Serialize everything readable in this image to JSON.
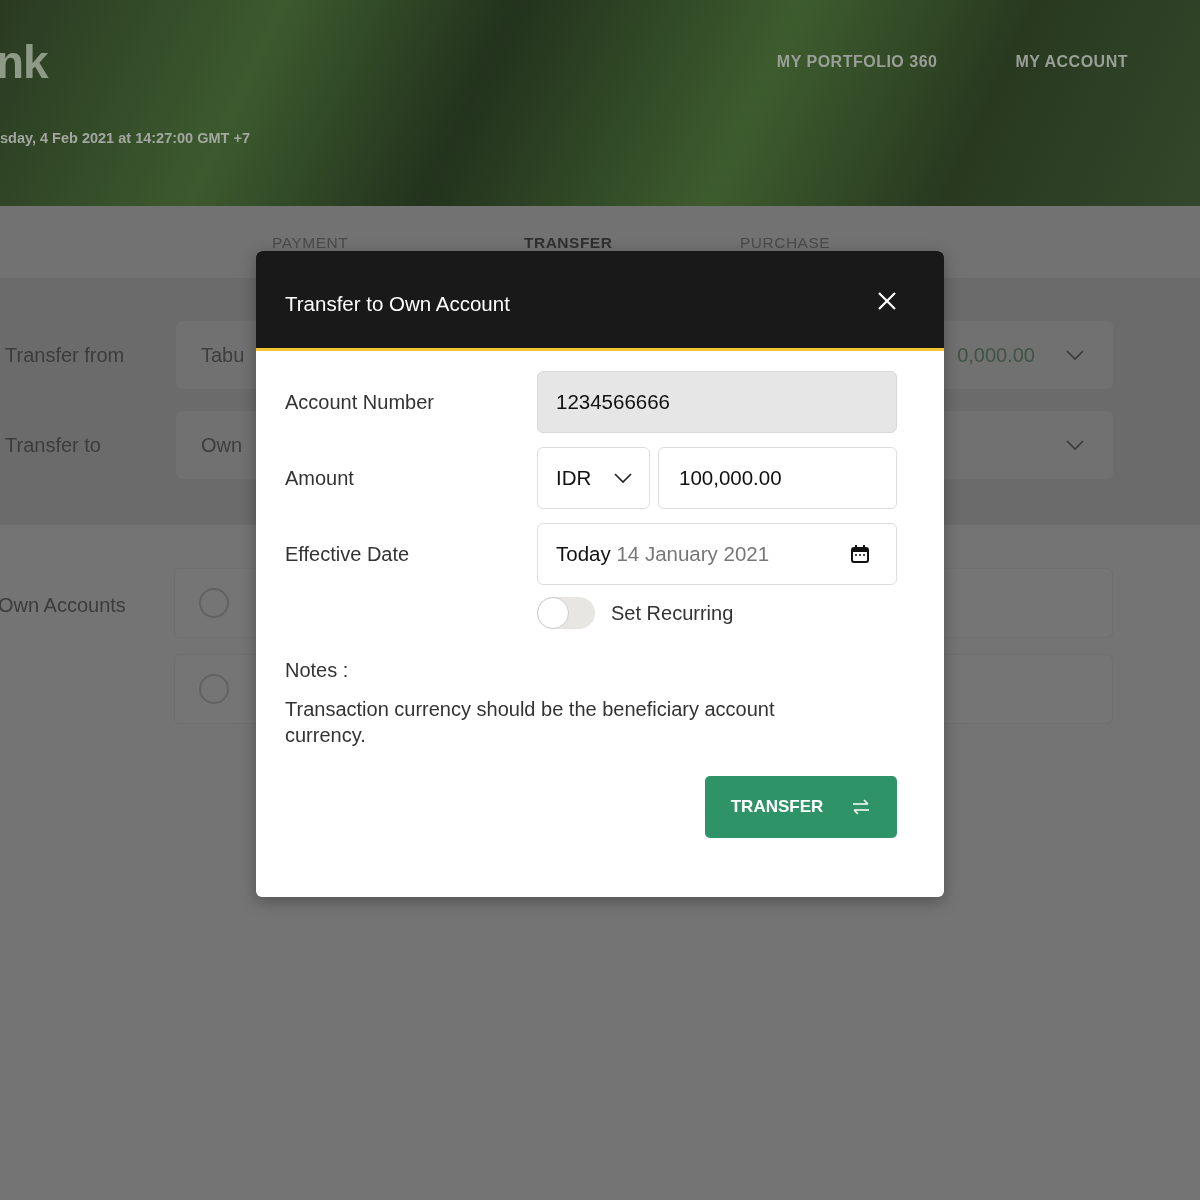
{
  "header": {
    "logo": "nk",
    "nav": [
      "MY PORTFOLIO 360",
      "MY ACCOUNT"
    ],
    "datetime": "sday, 4 Feb 2021 at 14:27:00 GMT +7"
  },
  "tabs": [
    {
      "label": "PAYMENT",
      "selected": false
    },
    {
      "label": "TRANSFER",
      "selected": true
    },
    {
      "label": "PURCHASE",
      "selected": false
    }
  ],
  "transfer_form": {
    "rows": [
      {
        "label": "Transfer from",
        "value": "Tabu",
        "amount": "0,000.00"
      },
      {
        "label": "Transfer to",
        "value": "Own"
      }
    ]
  },
  "own_accounts": {
    "label": "Own Accounts",
    "options": [
      {
        "selected": false
      },
      {
        "selected": false
      }
    ]
  },
  "dialog": {
    "title": "Transfer to Own Account",
    "account_number": {
      "label": "Account Number",
      "value": "1234566666"
    },
    "amount": {
      "label": "Amount",
      "currency": "IDR",
      "value": "100,000.00"
    },
    "effective_date": {
      "label": "Effective Date",
      "prefix": "Today",
      "value": "14 January 2021"
    },
    "recurring": {
      "label": "Set Recurring",
      "on": false
    },
    "notes_label": "Notes :",
    "notes": "Transaction currency should be the beneficiary account currency.",
    "button": "TRANSFER"
  }
}
